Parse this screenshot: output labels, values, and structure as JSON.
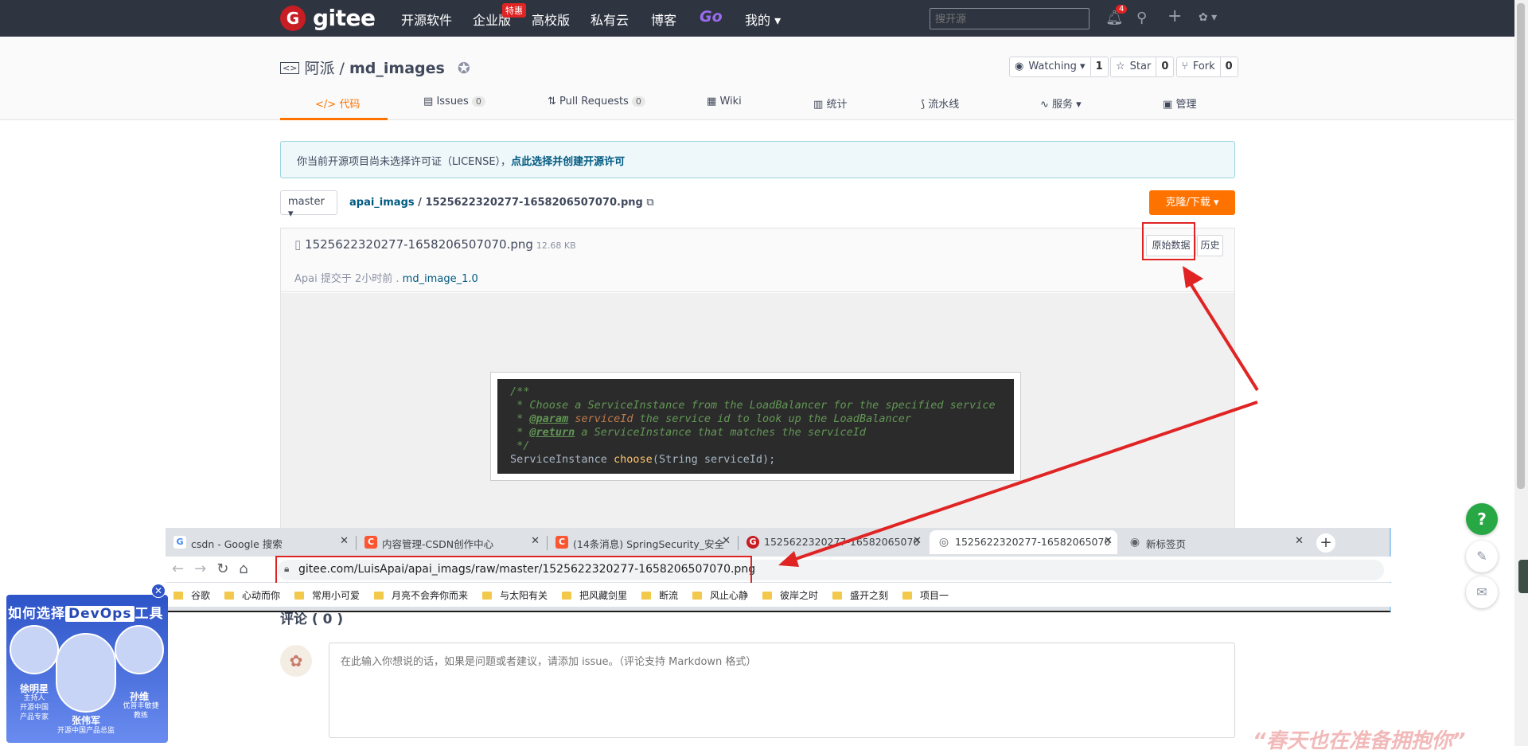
{
  "topnav": {
    "logo_glyph": "G",
    "brand": "gitee",
    "links": [
      "开源软件",
      "企业版",
      "高校版",
      "私有云",
      "博客",
      "Go",
      "我的 ▾"
    ],
    "promo_badge": "特惠",
    "search_placeholder": "搜开源",
    "notification_count": "4"
  },
  "repo": {
    "owner": "阿派",
    "separator": " / ",
    "name": "md_images",
    "watch_label": "Watching ▾",
    "watch_count": "1",
    "star_label": "Star",
    "star_count": "0",
    "fork_label": "Fork",
    "fork_count": "0",
    "tabs": [
      {
        "label": "代码"
      },
      {
        "label": "Issues",
        "count": "0"
      },
      {
        "label": "Pull Requests",
        "count": "0"
      },
      {
        "label": "Wiki"
      },
      {
        "label": "统计"
      },
      {
        "label": "流水线"
      },
      {
        "label": "服务 ▾"
      },
      {
        "label": "管理"
      }
    ]
  },
  "license": {
    "text": "你当前开源项目尚未选择许可证（LICENSE），",
    "link": "点此选择并创建开源许可"
  },
  "breadcrumb": {
    "branch": "master ▾",
    "folder": "apai_imags",
    "sep": " / ",
    "file": "1525622320277-1658206507070.png",
    "clone_label": "克隆/下载 ▾"
  },
  "file": {
    "name": "1525622320277-1658206507070.png",
    "size": "12.68 KB",
    "raw_label": "原始数据",
    "history_label": "历史",
    "commit_author": "Apai 提交于 2小时前 . ",
    "commit_msg": "md_image_1.0"
  },
  "code_image": {
    "l1": "/**",
    "l2_a": " * Choose a ServiceInstance from the LoadBalancer for the specified service",
    "l3_tag": "@param",
    "l3_param": "serviceId",
    "l3_rest": " the service id to look up the LoadBalancer",
    "l4_tag": "@return",
    "l4_rest": " a ServiceInstance that matches the serviceId",
    "l5": " */",
    "l6_a": "ServiceInstance ",
    "l6_fn": "choose",
    "l6_b": "(String serviceId);"
  },
  "browser": {
    "tabs": [
      {
        "icon": "G",
        "label": "csdn - Google 搜索"
      },
      {
        "icon": "C",
        "label": "内容管理-CSDN创作中心"
      },
      {
        "icon": "C",
        "label": "(14条消息) SpringSecurity_安全"
      },
      {
        "icon": "G",
        "label": "1525622320277-16582065070"
      },
      {
        "icon": "◎",
        "label": "1525622320277-16582065070"
      },
      {
        "icon": "◉",
        "label": "新标签页"
      }
    ],
    "url": "gitee.com/LuisApai/apai_imags/raw/master/1525622320277-1658206507070.png",
    "bookmarks": [
      "谷歌",
      "心动而你",
      "常用小可爱",
      "月亮不会奔你而来",
      "与太阳有关",
      "把风藏剑里",
      "断流",
      "风止心静",
      "彼岸之时",
      "盛开之刻",
      "项目一"
    ]
  },
  "comments": {
    "title": "评论 ( 0 )",
    "placeholder": "在此输入你想说的话，如果是问题或者建议，请添加 issue。（评论支持 Markdown 格式）"
  },
  "watermark": "“春天也在准备拥抱你”",
  "ad": {
    "title_a": "如何选择",
    "title_b": "DevOps",
    "title_c": "工具",
    "people": [
      {
        "name": "徐明星",
        "role": "主持人\n开源中国\n产品专家"
      },
      {
        "name": "张伟军",
        "role": "开源中国产品总监"
      },
      {
        "name": "孙维",
        "role": "优普丰敏捷\n教练"
      }
    ]
  },
  "floats": {
    "help": "?"
  },
  "colors": {
    "accent": "#fe7300",
    "nav_bg": "#2e3440",
    "link": "#005980",
    "highlight": "#e02424"
  }
}
